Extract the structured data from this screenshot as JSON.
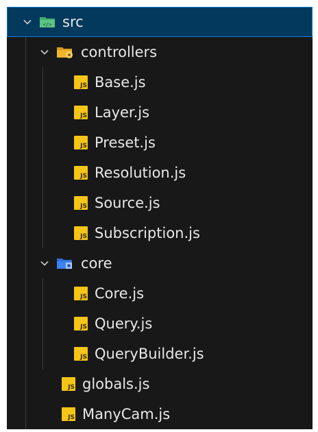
{
  "tree": {
    "root": {
      "label": "src",
      "icon": "src-folder-icon",
      "expanded": true
    },
    "controllers": {
      "label": "controllers",
      "icon": "controllers-folder-icon",
      "expanded": true,
      "files": [
        "Base.js",
        "Layer.js",
        "Preset.js",
        "Resolution.js",
        "Source.js",
        "Subscription.js"
      ]
    },
    "core": {
      "label": "core",
      "icon": "core-folder-icon",
      "expanded": true,
      "files": [
        "Core.js",
        "Query.js",
        "QueryBuilder.js"
      ]
    },
    "root_files": [
      "globals.js",
      "ManyCam.js"
    ],
    "file_icon_text": "JS"
  },
  "colors": {
    "background": "#181818",
    "selected_row": "#04395e",
    "selected_border": "#0078d4",
    "text": "#e8e8e8",
    "js_icon": "#f5c518",
    "src_folder": "#3fae6a",
    "controllers_folder": "#f0b429",
    "core_folder": "#3c82f0"
  }
}
